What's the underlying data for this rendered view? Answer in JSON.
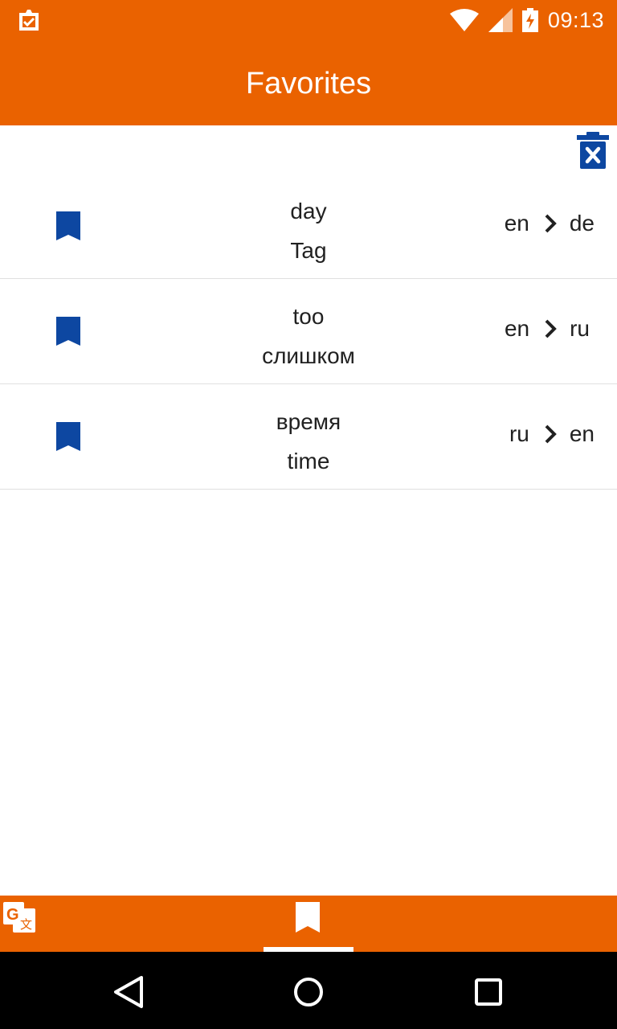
{
  "status_bar": {
    "time": "09:13",
    "icons": [
      "clipboard-check-icon",
      "wifi-icon",
      "signal-icon",
      "battery-charging-icon"
    ]
  },
  "app_bar": {
    "title": "Favorites"
  },
  "toolbar": {
    "clear_icon": "delete-forever-icon"
  },
  "favorites": [
    {
      "source": "day",
      "translation": "Tag",
      "from": "en",
      "to": "de"
    },
    {
      "source": "too",
      "translation": "слишком",
      "from": "en",
      "to": "ru"
    },
    {
      "source": "время",
      "translation": "time",
      "from": "ru",
      "to": "en"
    }
  ],
  "bottom_nav": {
    "tabs": [
      {
        "icon": "translate-icon",
        "selected": false
      },
      {
        "icon": "bookmark-icon",
        "selected": true
      }
    ]
  },
  "system_nav": {
    "icons": [
      "back-icon",
      "home-icon",
      "recents-icon"
    ]
  },
  "colors": {
    "primary": "#EA6200",
    "bookmark": "#0D47A1",
    "text": "#212121"
  }
}
